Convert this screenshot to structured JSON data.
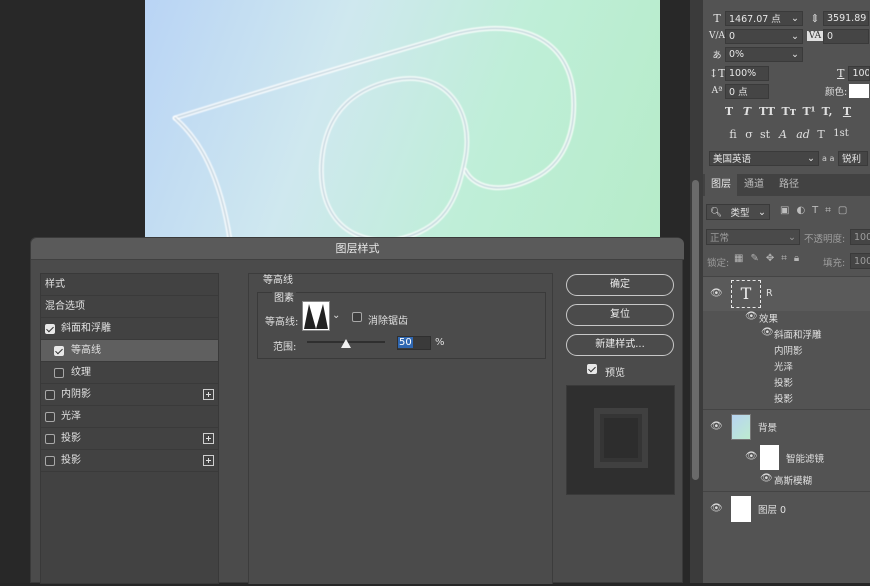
{
  "character_panel": {
    "font_size": "1467.07 点",
    "leading": "3591.89",
    "kerning": "0",
    "tracking": "0",
    "tsume": "0%",
    "vertical_scale": "100%",
    "horizontal_scale": "100",
    "baseline_shift": "0 点",
    "color_label": "颜色:",
    "language": "美国英语",
    "antialias": "锐利",
    "aa_prefix": "a a",
    "style_buttons": [
      "T",
      "T",
      "TT",
      "Tт",
      "T¹",
      "T,",
      "T"
    ],
    "opentype_buttons": [
      "fi",
      "σ",
      "st",
      "A",
      "ad",
      "T",
      "1st"
    ]
  },
  "layers_panel": {
    "tabs": [
      "图层",
      "通道",
      "路径"
    ],
    "filter_type": "类型",
    "blend_mode": "正常",
    "opacity_label": "不透明度:",
    "opacity_value": "100",
    "lock_label": "锁定:",
    "fill_label": "填充:",
    "fill_value": "100",
    "layers": {
      "text_layer": "R",
      "effects_label": "效果",
      "effects": [
        "斜面和浮雕",
        "内阴影",
        "光泽",
        "投影",
        "投影"
      ],
      "background": "背景",
      "smart_filters": "智能滤镜",
      "gaussian_blur": "高斯模糊",
      "layer0": "图层 0"
    }
  },
  "dialog": {
    "title": "图层样式",
    "styles_header": "样式",
    "blend_options": "混合选项",
    "items": [
      {
        "label": "斜面和浮雕",
        "checked": true
      },
      {
        "label": "等高线",
        "checked": true
      },
      {
        "label": "纹理",
        "checked": false
      },
      {
        "label": "内阴影",
        "checked": false
      },
      {
        "label": "光泽",
        "checked": false
      },
      {
        "label": "投影",
        "checked": false
      },
      {
        "label": "投影",
        "checked": false
      }
    ],
    "section_title": "等高线",
    "group_title": "图素",
    "contour_label": "等高线:",
    "antialias_label": "消除锯齿",
    "range_label": "范围:",
    "range_value": "50",
    "range_unit": "%",
    "range_fraction": 0.5,
    "buttons": {
      "ok": "确定",
      "reset": "复位",
      "new_style": "新建样式..."
    },
    "preview_label": "预览"
  }
}
